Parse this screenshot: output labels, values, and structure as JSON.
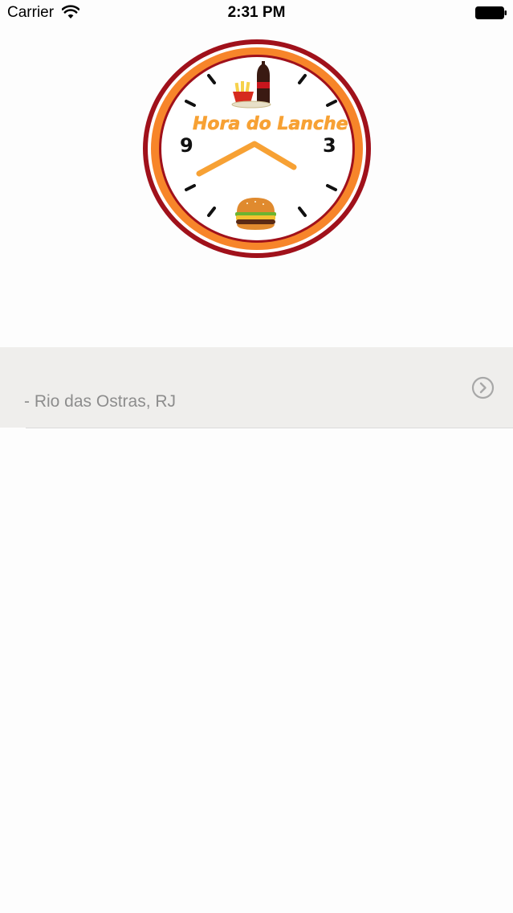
{
  "status_bar": {
    "carrier": "Carrier",
    "time": "2:31 PM",
    "icons": [
      "wifi-icon",
      "battery-icon"
    ]
  },
  "logo": {
    "text": "Hora do Lanche",
    "numeral_left": "9",
    "numeral_right": "3",
    "ring_outer_color": "#a0111b",
    "ring_inner_color": "#f7852a",
    "text_color": "#f7a134",
    "hands_color": "#f7a134"
  },
  "locations": [
    {
      "label": "- Rio das Ostras, RJ",
      "icon": "chevron-right-circle-icon"
    }
  ],
  "colors": {
    "row_background": "#efeeec",
    "row_text": "#8d8d8d",
    "background": "#fdfdfd"
  }
}
